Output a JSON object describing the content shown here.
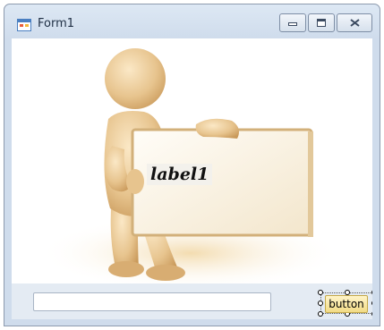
{
  "window": {
    "title": "Form1",
    "caption_buttons": [
      "minimize",
      "maximize",
      "close"
    ]
  },
  "form": {
    "label1": "label1",
    "text_input_value": "",
    "button_label": "button"
  },
  "icons": {
    "app": "form-app-icon",
    "minimize": "minimize-icon",
    "maximize": "maximize-icon",
    "close": "close-icon"
  },
  "colors": {
    "title_bar": "#dde8f4",
    "figure_skin": "#e7c48e",
    "board_border": "#d2b07a",
    "button_face": "#f2dc86"
  }
}
